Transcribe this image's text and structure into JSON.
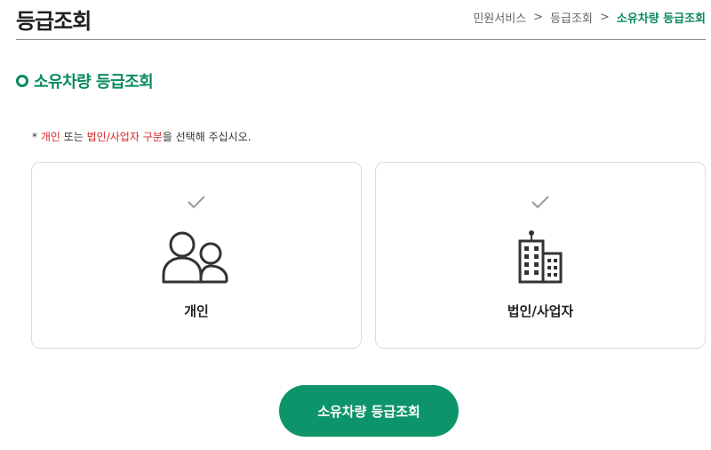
{
  "header": {
    "title": "등급조회",
    "breadcrumb": [
      "민원서비스",
      "등급조회",
      "소유차량 등급조회"
    ],
    "separator": ">"
  },
  "section": {
    "title": "소유차량 등급조회"
  },
  "notice": {
    "prefix": "* ",
    "opt1": "개인",
    "mid": " 또는 ",
    "opt2": "법인/사업자 구분",
    "suffix": "을 선택해 주십시오."
  },
  "options": [
    {
      "label": "개인",
      "icon": "people-icon"
    },
    {
      "label": "법인/사업자",
      "icon": "building-icon"
    }
  ],
  "submit": {
    "label": "소유차량 등급조회"
  },
  "colors": {
    "accent": "#0a8a5c",
    "button": "#0d946a",
    "highlight": "#d6262c"
  }
}
